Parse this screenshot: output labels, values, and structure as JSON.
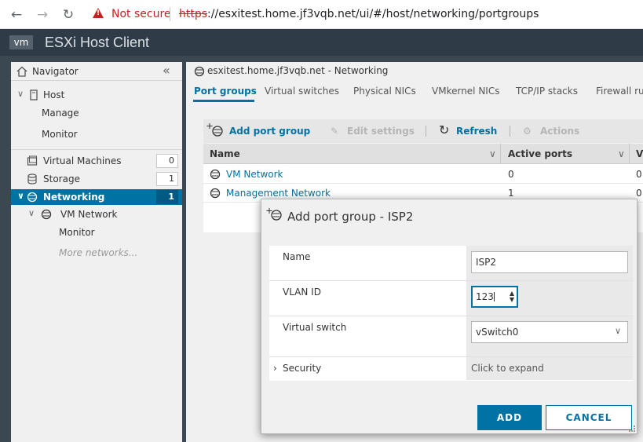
{
  "browser": {
    "not_secure": "Not secure",
    "url_scheme": "https",
    "url_rest": "://esxitest.home.jf3vqb.net/ui/#/host/networking/portgroups"
  },
  "app": {
    "logo": "vm",
    "title": "ESXi Host Client"
  },
  "navigator": {
    "title": "Navigator",
    "host": "Host",
    "manage": "Manage",
    "monitor": "Monitor",
    "items": [
      {
        "label": "Virtual Machines",
        "count": "0",
        "icon": "vm-icon"
      },
      {
        "label": "Storage",
        "count": "1",
        "icon": "storage-icon"
      },
      {
        "label": "Networking",
        "count": "1",
        "icon": "network-icon"
      }
    ],
    "vm_network": "VM Network",
    "vm_network_monitor": "Monitor",
    "more_networks": "More networks..."
  },
  "content": {
    "title": "esxitest.home.jf3vqb.net - Networking",
    "tabs": [
      "Port groups",
      "Virtual switches",
      "Physical NICs",
      "VMkernel NICs",
      "TCP/IP stacks",
      "Firewall ru"
    ],
    "toolbar": {
      "add": "Add port group",
      "edit": "Edit settings",
      "refresh": "Refresh",
      "actions": "Actions"
    },
    "grid": {
      "columns": [
        "Name",
        "Active ports",
        "V"
      ],
      "rows": [
        {
          "name": "VM Network",
          "active": "0",
          "v": "0"
        },
        {
          "name": "Management Network",
          "active": "1",
          "v": "0"
        }
      ]
    }
  },
  "dialog": {
    "title": "Add port group - ISP2",
    "name_label": "Name",
    "name_value": "ISP2",
    "vlan_label": "VLAN ID",
    "vlan_value": "123",
    "vswitch_label": "Virtual switch",
    "vswitch_value": "vSwitch0",
    "security_label": "Security",
    "security_value": "Click to expand",
    "add_button": "ADD",
    "cancel_button": "CANCEL"
  },
  "colors": {
    "accent": "#0072a3",
    "header": "#2f3b46",
    "danger": "#c5221f"
  }
}
